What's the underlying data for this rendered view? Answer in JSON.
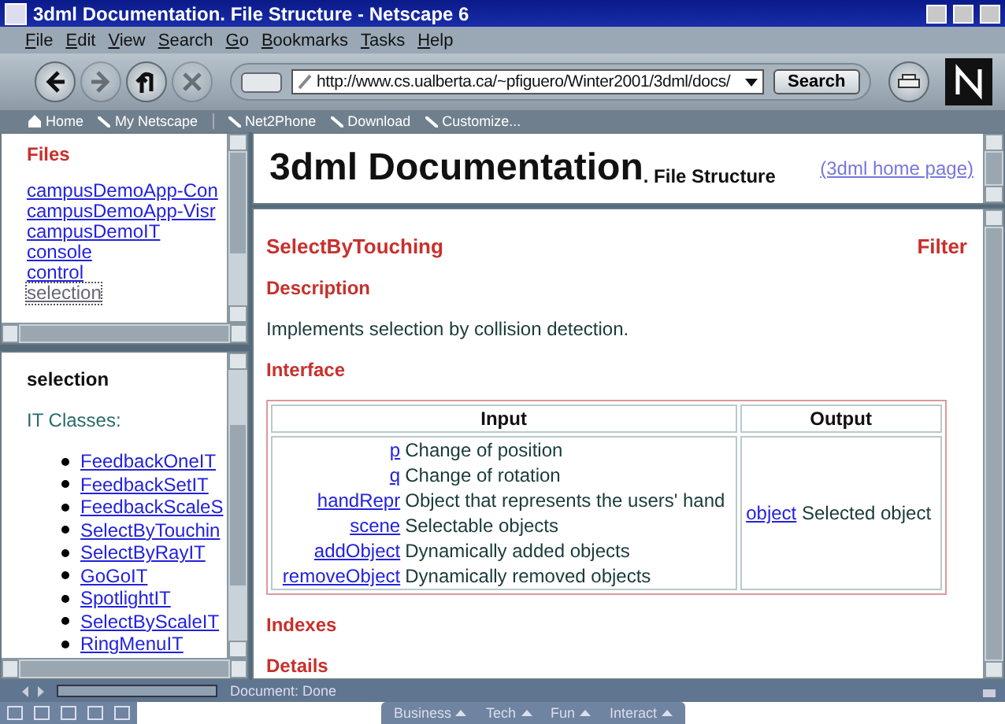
{
  "window": {
    "title": "3dml Documentation. File Structure - Netscape 6"
  },
  "menu": [
    "File",
    "Edit",
    "View",
    "Search",
    "Go",
    "Bookmarks",
    "Tasks",
    "Help"
  ],
  "navigation": {
    "buttons": [
      {
        "kind": "back",
        "disabled": false
      },
      {
        "kind": "forward",
        "disabled": true
      },
      {
        "kind": "reload",
        "disabled": false
      },
      {
        "kind": "stop",
        "disabled": true
      }
    ],
    "url": "http://www.cs.ualberta.ca/~pfiguero/Winter2001/3dml/docs/",
    "search_button": "Search"
  },
  "personal_toolbar": [
    {
      "kind": "home",
      "label": "Home"
    },
    {
      "kind": "bookmark",
      "label": "My Netscape"
    },
    {
      "kind": "bookmark",
      "label": "Net2Phone"
    },
    {
      "kind": "bookmark",
      "label": "Download"
    },
    {
      "kind": "bookmark",
      "label": "Customize..."
    }
  ],
  "files_frame": {
    "heading": "Files",
    "links": [
      {
        "label": "campusDemoApp-Con",
        "selected": false
      },
      {
        "label": "campusDemoApp-Visr",
        "selected": false
      },
      {
        "label": "campusDemoIT",
        "selected": false
      },
      {
        "label": "console",
        "selected": false
      },
      {
        "label": "control",
        "selected": false
      },
      {
        "label": "selection",
        "selected": true
      }
    ]
  },
  "classes_frame": {
    "heading": "selection",
    "subheading": "IT Classes:",
    "links": [
      "FeedbackOneIT",
      "FeedbackSetIT",
      "FeedbackScaleS",
      "SelectByTouchin",
      "SelectByRayIT",
      "GoGoIT",
      "SpotlightIT",
      "SelectByScaleIT",
      "RingMenuIT"
    ]
  },
  "header_frame": {
    "title": "3dml Documentation",
    "suffix": ". File Structure",
    "link": "(3dml home page)"
  },
  "doc": {
    "name": "SelectByTouching",
    "category": "Filter",
    "description_heading": "Description",
    "description": "Implements selection by collision detection.",
    "interface_heading": "Interface",
    "table": {
      "columns": [
        "Input",
        "Output"
      ],
      "inputs": [
        {
          "name": "p",
          "desc": "Change of position"
        },
        {
          "name": "q",
          "desc": "Change of rotation"
        },
        {
          "name": "handRepr",
          "desc": "Object that represents the users' hand"
        },
        {
          "name": "scene",
          "desc": "Selectable objects"
        },
        {
          "name": "addObject",
          "desc": "Dynamically added objects"
        },
        {
          "name": "removeObject",
          "desc": "Dynamically removed objects"
        }
      ],
      "output": {
        "name": "object",
        "desc": "Selected object"
      }
    },
    "more_headings": [
      "Indexes",
      "Details"
    ]
  },
  "status_bar": {
    "text": "Document: Done",
    "progress": {
      "level": 0
    }
  },
  "taskbar": {
    "tabs": [
      "Business",
      "Tech",
      "Fun",
      "Interact"
    ]
  }
}
